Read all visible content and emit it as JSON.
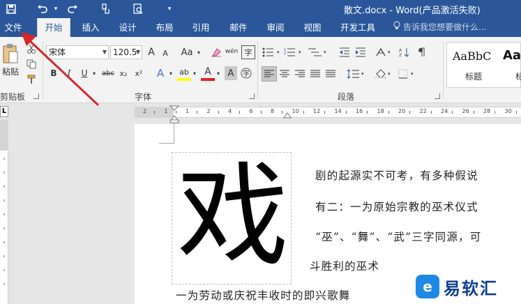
{
  "window": {
    "title": "散文.docx - Word(产品激活失败)",
    "quick_access": [
      "save-icon",
      "undo-icon",
      "redo-icon",
      "touch-mode-icon",
      "print-preview-icon",
      "customize-icon"
    ]
  },
  "tabs": {
    "file": "文件",
    "items": [
      "开始",
      "插入",
      "设计",
      "布局",
      "引用",
      "邮件",
      "审阅",
      "视图",
      "开发工具"
    ],
    "active": "开始",
    "tell_me": "告诉我您想要做什么..."
  },
  "ribbon": {
    "clipboard": {
      "paste": "粘贴",
      "label": "剪贴板"
    },
    "font": {
      "name": "宋体",
      "size": "120.5",
      "grow": "A",
      "shrink": "A",
      "change_case": "Aa",
      "phonetic": "wén",
      "bold": "B",
      "italic": "I",
      "underline": "U",
      "strikethrough": "abc",
      "subscript": "x₂",
      "superscript": "x²",
      "text_effects": "A",
      "highlight": "ab",
      "font_color": "A",
      "char_shading": "A",
      "enclose": "字",
      "label": "字体"
    },
    "paragraph": {
      "label": "段落"
    },
    "styles": [
      {
        "preview": "AaBbC",
        "name": "标题"
      },
      {
        "preview": "Aa",
        "name": "标"
      }
    ]
  },
  "ruler": {
    "numbers": [
      "2",
      "1",
      "1",
      "2",
      "4",
      "6",
      "8",
      "10",
      "12",
      "14",
      "16",
      "18",
      "20",
      "22",
      "24",
      "26",
      "28",
      "30"
    ],
    "corner": "L"
  },
  "document": {
    "dropcap": "戏",
    "lines": [
      "剧的起源实不可考，有多种假说",
      "有二：一为原始宗教的巫术仪式",
      "“巫”、“舞”、“武”三字同源，可",
      "斗胜利的巫术",
      "一为劳动或庆祝丰收时的即兴歌舞"
    ]
  },
  "watermark": {
    "text": "易软汇",
    "logo": "e"
  },
  "colors": {
    "titlebar": "#2b579a",
    "ribbon": "#f3f3f3",
    "arrow": "#d9262a"
  }
}
